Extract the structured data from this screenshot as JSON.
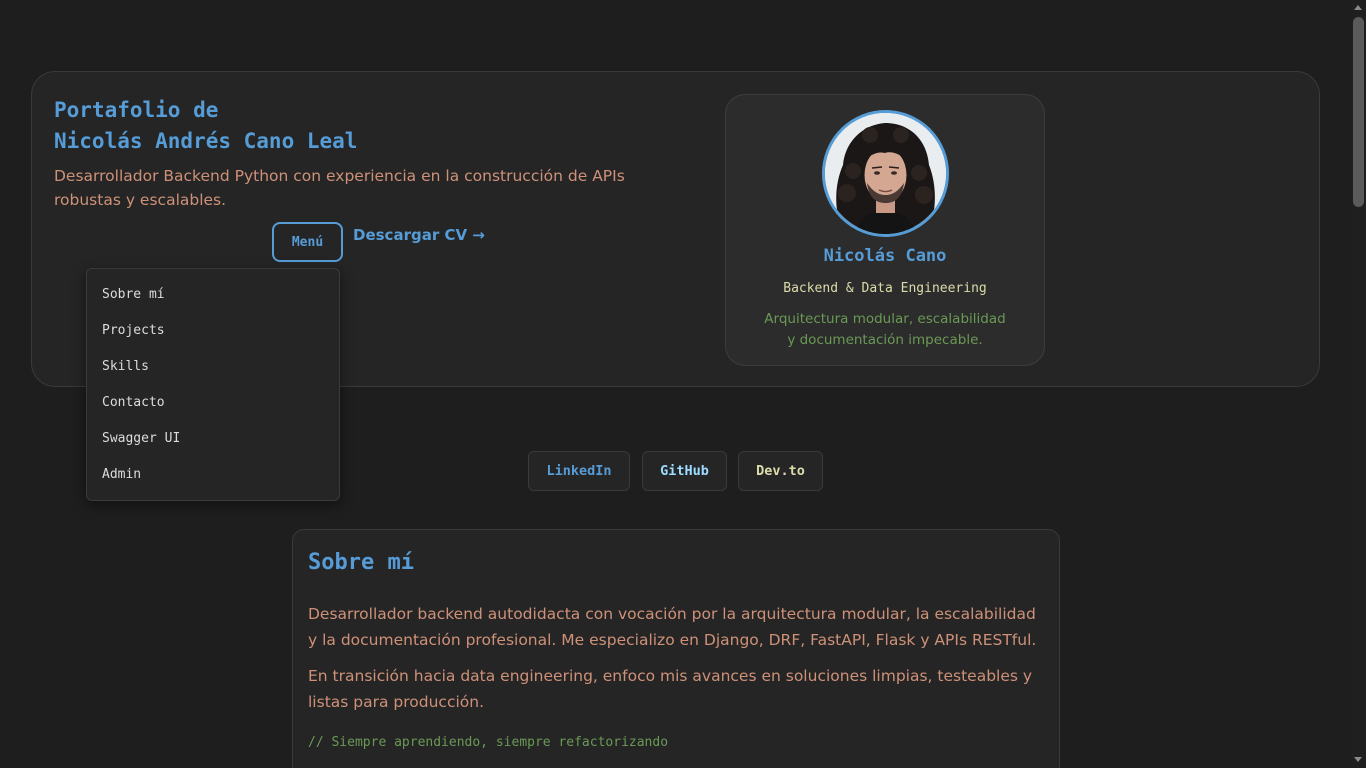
{
  "hero": {
    "title_line1": "Portafolio de",
    "title_line2": "Nicolás Andrés Cano Leal",
    "description": "Desarrollador Backend Python con experiencia en la construcción de APIs robustas y escalables.",
    "menu_button": "Menú",
    "cv_link": "Descargar CV →"
  },
  "menu": {
    "items": [
      "Sobre mí",
      "Projects",
      "Skills",
      "Contacto",
      "Swagger UI",
      "Admin"
    ]
  },
  "profile": {
    "name": "Nicolás Cano",
    "role": "Backend & Data Engineering",
    "tagline": "Arquitectura modular, escalabilidad y documentación impecable."
  },
  "social": {
    "linkedin": "LinkedIn",
    "github": "GitHub",
    "devto": "Dev.to"
  },
  "about": {
    "title": "Sobre mí",
    "paragraph1": "Desarrollador backend autodidacta con vocación por la arquitectura modular, la escalabilidad y la documentación profesional. Me especializo en Django, DRF, FastAPI, Flask y APIs RESTful.",
    "paragraph2": "En transición hacia data engineering, enfoco mis avances en soluciones limpias, testeables y listas para producción.",
    "comment": "// Siempre aprendiendo, siempre refactorizando"
  },
  "colors": {
    "background": "#1e1e1e",
    "accent": "#569cd6",
    "text_orange": "#ce9178",
    "text_green": "#6a9955",
    "text_yellow": "#dcdcaa"
  }
}
